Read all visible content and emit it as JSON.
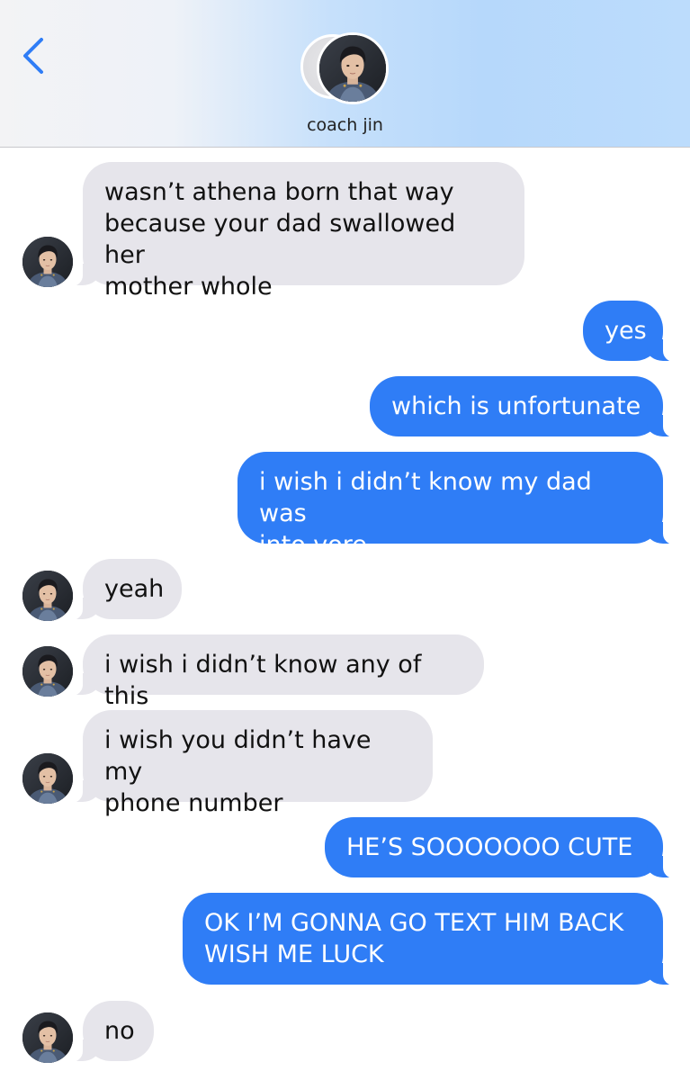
{
  "header": {
    "contact_name": "coach jin",
    "back_icon": "chevron-left-icon"
  },
  "colors": {
    "incoming_bubble": "#e6e5eb",
    "outgoing_bubble": "#2f7df6",
    "accent": "#2f7df6"
  },
  "messages": [
    {
      "direction": "incoming",
      "text": "wasn’t athena born that way\nbecause your dad swallowed her\nmother whole"
    },
    {
      "direction": "outgoing",
      "text": "yes"
    },
    {
      "direction": "outgoing",
      "text": "which is unfortunate"
    },
    {
      "direction": "outgoing",
      "text": "i wish i didn’t know my dad was\ninto vore"
    },
    {
      "direction": "incoming",
      "text": "yeah"
    },
    {
      "direction": "incoming",
      "text": "i wish i didn’t know any of this"
    },
    {
      "direction": "incoming",
      "text": "i wish you didn’t have my\nphone number"
    },
    {
      "direction": "outgoing",
      "text": "HE’S SOOOOOOO CUTE"
    },
    {
      "direction": "outgoing",
      "text": "OK I’M GONNA GO TEXT HIM BACK\nWISH ME LUCK"
    },
    {
      "direction": "incoming",
      "text": "no"
    }
  ]
}
